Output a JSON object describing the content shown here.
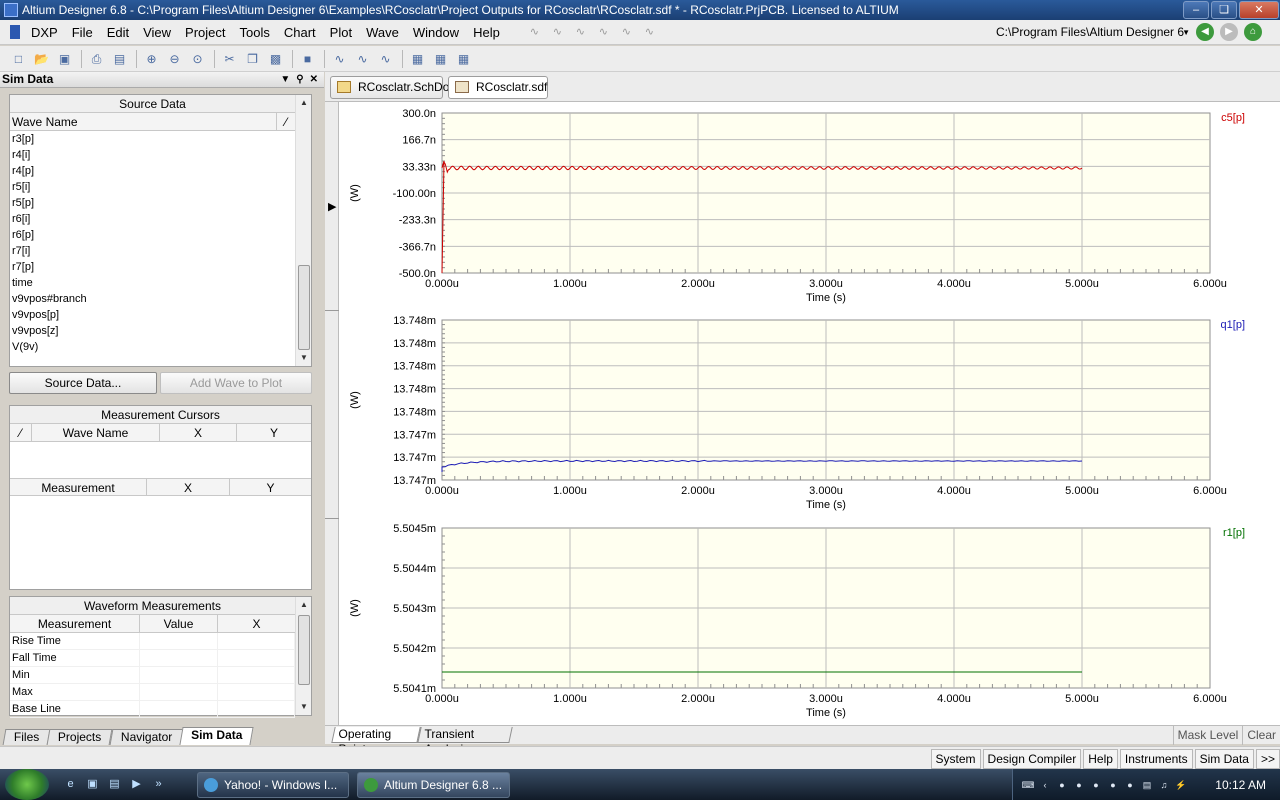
{
  "window": {
    "title": "Altium Designer 6.8 - C:\\Program Files\\Altium Designer 6\\Examples\\RCosclatr\\Project Outputs for RCosclatr\\RCosclatr.sdf * - RCosclatr.PrjPCB. Licensed to ALTIUM"
  },
  "menubar": {
    "items": [
      "DXP",
      "File",
      "Edit",
      "View",
      "Project",
      "Tools",
      "Chart",
      "Plot",
      "Wave",
      "Window",
      "Help"
    ],
    "path": "C:\\Program Files\\Altium Designer 6"
  },
  "panel": {
    "title": "Sim Data",
    "source_data": {
      "title": "Source Data",
      "column": "Wave Name",
      "waves": [
        "r3[p]",
        "r4[i]",
        "r4[p]",
        "r5[i]",
        "r5[p]",
        "r6[i]",
        "r6[p]",
        "r7[i]",
        "r7[p]",
        "time",
        "v9vpos#branch",
        "v9vpos[p]",
        "v9vpos[z]",
        "V(9v)"
      ]
    },
    "source_button": "Source Data...",
    "add_wave_button": "Add Wave to Plot",
    "cursors": {
      "title": "Measurement Cursors",
      "col_wave": "Wave Name",
      "col_x": "X",
      "col_y": "Y",
      "col_meas": "Measurement"
    },
    "waveform": {
      "title": "Waveform Measurements",
      "col_meas": "Measurement",
      "col_value": "Value",
      "col_x": "X",
      "rows": [
        "Rise Time",
        "Fall Time",
        "Min",
        "Max",
        "Base Line"
      ]
    },
    "tabs": [
      "Files",
      "Projects",
      "Navigator",
      "Sim Data"
    ]
  },
  "doc_tabs": [
    "RCosclatr.SchDoc",
    "RCosclatr.sdf *"
  ],
  "analysis_tabs": [
    "Operating Point",
    "Transient Analysis"
  ],
  "mask": {
    "mask_level": "Mask Level",
    "clear": "Clear"
  },
  "status": {
    "items": [
      "System",
      "Design Compiler",
      "Help",
      "Instruments",
      "Sim Data",
      ">>"
    ]
  },
  "taskbar": {
    "tasks": [
      "Yahoo! - Windows I...",
      "Altium Designer 6.8 ..."
    ],
    "clock": "10:12 AM"
  },
  "colors": {
    "plot_bg": "#fffff0",
    "grid": "#bdbdbd",
    "c5": "#cc0000",
    "q1": "#1a1ab4",
    "r1": "#007000"
  },
  "chart_data": [
    {
      "type": "line",
      "series": [
        {
          "name": "c5[p]"
        }
      ],
      "ylabel": "(W)",
      "xlabel": "Time (s)",
      "ylim": [
        -5e-07,
        3e-07
      ],
      "yticks": [
        "300.0n",
        "166.7n",
        "33.33n",
        "-100.00n",
        "-233.3n",
        "-366.7n",
        "-500.0n"
      ],
      "xticks": [
        "0.000u",
        "1.000u",
        "2.000u",
        "3.000u",
        "4.000u",
        "5.000u",
        "6.000u"
      ],
      "xlim": [
        0,
        6
      ],
      "data_end": 5.0,
      "center": 2.5e-08,
      "amplitude": 9e-09,
      "cycles": 75
    },
    {
      "type": "line",
      "series": [
        {
          "name": "q1[p]"
        }
      ],
      "ylabel": "(W)",
      "xlabel": "Time (s)",
      "yticks": [
        "13.748m",
        "13.748m",
        "13.748m",
        "13.748m",
        "13.748m",
        "13.747m",
        "13.747m",
        "13.747m"
      ],
      "xticks": [
        "0.000u",
        "1.000u",
        "2.000u",
        "3.000u",
        "4.000u",
        "5.000u",
        "6.000u"
      ],
      "xlim": [
        0,
        6
      ],
      "data_end": 5.0
    },
    {
      "type": "line",
      "series": [
        {
          "name": "r1[p]"
        }
      ],
      "ylabel": "(W)",
      "xlabel": "Time (s)",
      "yticks": [
        "5.5045m",
        "5.5044m",
        "5.5043m",
        "5.5042m",
        "5.5041m"
      ],
      "xticks": [
        "0.000u",
        "1.000u",
        "2.000u",
        "3.000u",
        "4.000u",
        "5.000u",
        "6.000u"
      ],
      "xlim": [
        0,
        6
      ],
      "data_end": 5.0
    }
  ]
}
